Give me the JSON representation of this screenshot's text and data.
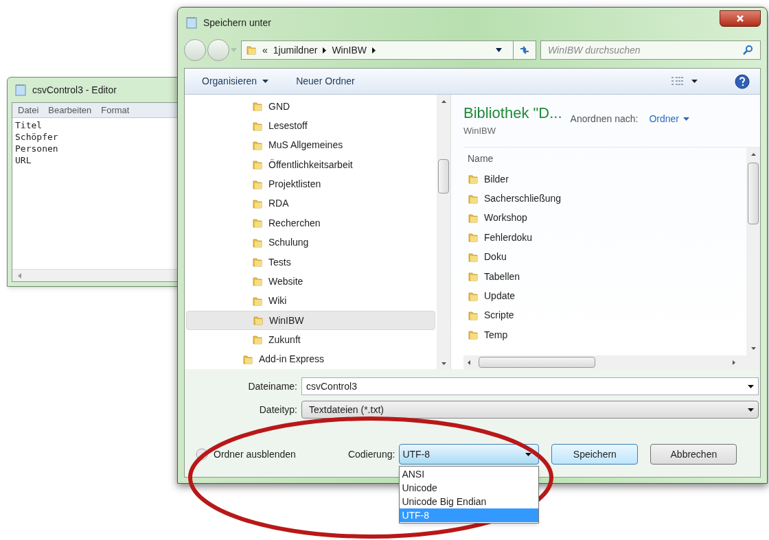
{
  "editor": {
    "title": "csvControl3 - Editor",
    "menu": [
      "Datei",
      "Bearbeiten",
      "Format"
    ],
    "lines": [
      "Titel",
      "Schöpfer",
      "Personen",
      "URL"
    ]
  },
  "dialog": {
    "title": "Speichern unter",
    "breadcrumb": [
      "«",
      "1jumildner",
      "WinIBW"
    ],
    "search": {
      "placeholder": "WinIBW durchsuchen"
    },
    "toolbar": [
      "Organisieren",
      "Neuer Ordner"
    ],
    "tree": {
      "nested_items": [
        {
          "label": "GND",
          "selected": false
        },
        {
          "label": "Lesestoff",
          "selected": false
        },
        {
          "label": "MuS Allgemeines",
          "selected": false
        },
        {
          "label": "Öffentlichkeitsarbeit",
          "selected": false
        },
        {
          "label": "Projektlisten",
          "selected": false
        },
        {
          "label": "RDA",
          "selected": false
        },
        {
          "label": "Recherchen",
          "selected": false
        },
        {
          "label": "Schulung",
          "selected": false
        },
        {
          "label": "Tests",
          "selected": false
        },
        {
          "label": "Website",
          "selected": false
        },
        {
          "label": "Wiki",
          "selected": false
        },
        {
          "label": "WinIBW",
          "selected": true
        },
        {
          "label": "Zukunft",
          "selected": false
        }
      ],
      "top_level_items": [
        {
          "label": "Add-in Express",
          "selected": false
        }
      ]
    },
    "library": {
      "title": "Bibliothek \"D...",
      "subtitle": "WinIBW",
      "arrange_label": "Anordnen nach:",
      "arrange_value": "Ordner",
      "column": "Name",
      "folders": [
        "Bilder",
        "Sacherschließung",
        "Workshop",
        "Fehlerdoku",
        "Doku",
        "Tabellen",
        "Update",
        "Scripte",
        "Temp"
      ]
    },
    "filename": {
      "label": "Dateiname:",
      "value": "csvControl3"
    },
    "filetype": {
      "label": "Dateityp:",
      "value": "Textdateien (*.txt)"
    },
    "hide_folders": "Ordner ausblenden",
    "encoding": {
      "label": "Codierung:",
      "value": "UTF-8",
      "options": [
        {
          "label": "ANSI",
          "selected": false
        },
        {
          "label": "Unicode",
          "selected": false
        },
        {
          "label": "Unicode Big Endian",
          "selected": false
        },
        {
          "label": "UTF-8",
          "selected": true
        }
      ]
    },
    "buttons": [
      "Speichern",
      "Abbrechen"
    ]
  }
}
